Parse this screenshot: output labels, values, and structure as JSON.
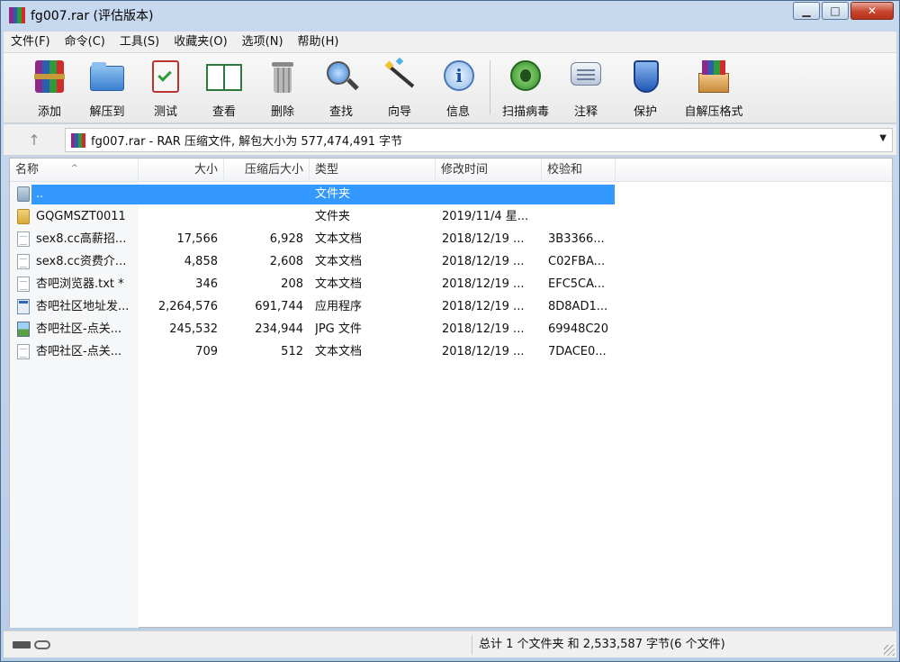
{
  "window": {
    "title": "fg007.rar (评估版本)",
    "min_label": "▁",
    "max_label": "□",
    "close_label": "✕"
  },
  "menu": [
    "文件(F)",
    "命令(C)",
    "工具(S)",
    "收藏夹(O)",
    "选项(N)",
    "帮助(H)"
  ],
  "toolbar": [
    {
      "label": "添加",
      "icon": "add-archive-icon"
    },
    {
      "label": "解压到",
      "icon": "extract-to-folder-icon"
    },
    {
      "label": "测试",
      "icon": "test-clipboard-icon"
    },
    {
      "label": "查看",
      "icon": "view-book-icon"
    },
    {
      "label": "删除",
      "icon": "delete-trash-icon"
    },
    {
      "label": "查找",
      "icon": "find-magnifier-icon"
    },
    {
      "label": "向导",
      "icon": "wizard-wand-icon"
    },
    {
      "label": "信息",
      "icon": "info-icon"
    },
    {
      "label": "扫描病毒",
      "icon": "virus-scan-icon"
    },
    {
      "label": "注释",
      "icon": "comment-icon"
    },
    {
      "label": "保护",
      "icon": "shield-icon"
    },
    {
      "label": "自解压格式",
      "icon": "sfx-box-icon"
    }
  ],
  "address": {
    "up_label": "↑",
    "path_text": "fg007.rar - RAR 压缩文件, 解包大小为 577,474,491 字节",
    "dropdown_label": "▼"
  },
  "columns": [
    "名称",
    "大小",
    "压缩后大小",
    "类型",
    "修改时间",
    "校验和"
  ],
  "sort_indicator": "^",
  "files": [
    {
      "name": "..",
      "size": "",
      "packed": "",
      "type": "文件夹",
      "modified": "",
      "crc": "",
      "icon": "folder-up",
      "selected": true
    },
    {
      "name": "GQGMSZT0011",
      "size": "",
      "packed": "",
      "type": "文件夹",
      "modified": "2019/11/4 星...",
      "crc": "",
      "icon": "folder",
      "selected": false
    },
    {
      "name": "sex8.cc高薪招...",
      "size": "17,566",
      "packed": "6,928",
      "type": "文本文档",
      "modified": "2018/12/19 ...",
      "crc": "3B3366...",
      "icon": "text",
      "selected": false
    },
    {
      "name": "sex8.cc资费介...",
      "size": "4,858",
      "packed": "2,608",
      "type": "文本文档",
      "modified": "2018/12/19 ...",
      "crc": "C02FBA...",
      "icon": "text",
      "selected": false
    },
    {
      "name": "杏吧浏览器.txt *",
      "size": "346",
      "packed": "208",
      "type": "文本文档",
      "modified": "2018/12/19 ...",
      "crc": "EFC5CA...",
      "icon": "text",
      "selected": false
    },
    {
      "name": "杏吧社区地址发...",
      "size": "2,264,576",
      "packed": "691,744",
      "type": "应用程序",
      "modified": "2018/12/19 ...",
      "crc": "8D8AD1...",
      "icon": "exe",
      "selected": false
    },
    {
      "name": "杏吧社区-点关...",
      "size": "245,532",
      "packed": "234,944",
      "type": "JPG 文件",
      "modified": "2018/12/19 ...",
      "crc": "69948C20",
      "icon": "jpg",
      "selected": false
    },
    {
      "name": "杏吧社区-点关...",
      "size": "709",
      "packed": "512",
      "type": "文本文档",
      "modified": "2018/12/19 ...",
      "crc": "7DACE0...",
      "icon": "text",
      "selected": false
    }
  ],
  "status": {
    "summary": "总计 1 个文件夹 和 2,533,587 字节(6 个文件)"
  },
  "colors": {
    "selection": "#3399ff",
    "title_gradient": "#c6d9ee",
    "close_button": "#c6462d"
  }
}
